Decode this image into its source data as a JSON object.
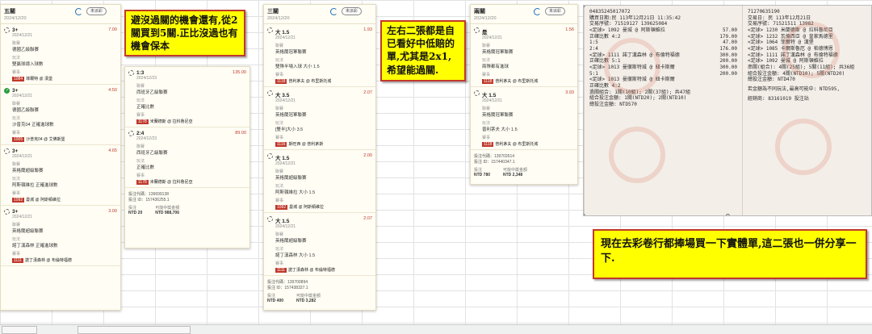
{
  "panels": {
    "p1": {
      "title": "五關",
      "date": "2024/12/20",
      "button": "未派彩",
      "bets": [
        {
          "sel": "3+",
          "date": "2024/12/21",
          "odds": "7.00",
          "state": "pending",
          "l1": "聯賽",
          "v1": "德國乙級聯賽",
          "l2": "玩法",
          "v2": "雙贏球總入球數",
          "l3": "賽事",
          "code": "1084",
          "match": "菲爾特 @ 漢堡"
        },
        {
          "sel": "3+",
          "date": "2024/12/21",
          "odds": "4.50",
          "state": "win",
          "l1": "聯賽",
          "v1": "德國乙級聯賽",
          "l2": "玩法",
          "v2": "沙普克04 正確進球數",
          "l3": "賽事",
          "code": "1005",
          "match": "沙普克04 @ 艾佛斯堡"
        },
        {
          "sel": "3+",
          "date": "2024/12/21",
          "odds": "4.65",
          "state": "pending",
          "l1": "聯賽",
          "v1": "英格蘭超級聯賽",
          "l2": "玩法",
          "v2": "阿斯頓維拉 正確進球數",
          "l3": "賽事",
          "code": "1092",
          "match": "曼城 @ 阿斯頓維拉"
        },
        {
          "sel": "3+",
          "date": "2024/12/21",
          "odds": "3.00",
          "state": "pending",
          "l1": "聯賽",
          "v1": "英格蘭超級聯賽",
          "l2": "玩法",
          "v2": "諾丁漢森林 正確進球數",
          "l3": "賽事",
          "code": "1111",
          "match": "諾丁漢森林 @ 布倫特福德"
        }
      ]
    },
    "p2": {
      "bets": [
        {
          "sel": "1:3",
          "date": "2024/12/23",
          "odds": "135.00",
          "l1": "聯賽",
          "v1": "西班牙乙級聯賽",
          "l2": "玩法",
          "v2": "正確比數",
          "l3": "賽事",
          "code": "1178",
          "match": "米蘭德斯 @ 拉科魯尼亞"
        },
        {
          "sel": "2:4",
          "date": "2024/12/23",
          "odds": "89.00",
          "l1": "聯賽",
          "v1": "西班牙乙級聯賽",
          "l2": "玩法",
          "v2": "正確比數",
          "l3": "賽事",
          "code": "1178",
          "match": "米蘭德斯 @ 拉科魯尼亞"
        }
      ],
      "foot_code": "投注代碼：139699138",
      "foot_id": "投注 ID：157436255.1",
      "stake_k": "投注",
      "stake_v": "NTD 20",
      "pay_k": "可能中獎金額",
      "pay_v": "NTD 988,706"
    },
    "p3": {
      "title": "三關",
      "date": "2024/12/20",
      "button": "未派彩",
      "bets": [
        {
          "sel": "大 1.5",
          "date": "2024/12/21",
          "odds": "1.93",
          "l1": "聯賽",
          "v1": "英格蘭冠軍聯賽",
          "l2": "玩法",
          "v2": "雙隊半場入球 大小 1.5",
          "l3": "賽事",
          "code": "1118",
          "match": "普利茅夫 @ 布里斯托城"
        },
        {
          "sel": "大 3.5",
          "date": "2024/12/21",
          "odds": "2.07",
          "l1": "聯賽",
          "v1": "英格蘭冠軍聯賽",
          "l2": "玩法",
          "v2": "[雙半]大小 3.5",
          "l3": "賽事",
          "code": "1116",
          "match": "斯旺西 @ 普利茅斯"
        },
        {
          "sel": "大 1.5",
          "date": "2024/12/21",
          "odds": "2.00",
          "l1": "聯賽",
          "v1": "英格蘭超級聯賽",
          "l2": "玩法",
          "v2": "阿斯頓維拉 大小 1.5",
          "l3": "賽事",
          "code": "1092",
          "match": "曼城 @ 阿斯頓維拉"
        },
        {
          "sel": "大 1.5",
          "date": "2024/12/21",
          "odds": "2.07",
          "l1": "聯賽",
          "v1": "英格蘭超級聯賽",
          "l2": "玩法",
          "v2": "諾丁漢森林 大小 1.5",
          "l3": "賽事",
          "code": "1111",
          "match": "諾丁漢森林 @ 布倫特福德"
        }
      ],
      "foot_code": "投注代碼：139700894",
      "foot_id": "投注 ID：157438327.1",
      "stake_k": "投注",
      "stake_v": "NTD 400",
      "pay_k": "可能中獎金額",
      "pay_v": "NTD 3,282"
    },
    "p4": {
      "title": "兩關",
      "date": "2024/12/20",
      "button": "未派彩",
      "bets": [
        {
          "sel": "是",
          "date": "2024/12/21",
          "odds": "1.56",
          "l1": "聯賽",
          "v1": "英格蘭冠軍聯賽",
          "l2": "玩法",
          "v2": "兩隊都有進球",
          "l3": "賽事",
          "code": "1118",
          "match": "普利茅夫 @ 布里斯托城"
        },
        {
          "sel": "大 1.5",
          "date": "2024/12/21",
          "odds": "3.93",
          "l1": "聯賽",
          "v1": "英格蘭冠軍聯賽",
          "l2": "玩法",
          "v2": "普利茅夫 大小 1.5",
          "l3": "賽事",
          "code": "1118",
          "match": "普利茅夫 @ 布里斯托城"
        }
      ],
      "foot_code": "投注代碼：139702614",
      "foot_id": "投注 ID：157440347.1",
      "stake_k": "投注",
      "stake_v": "NTD 780",
      "pay_k": "可能中獎金額",
      "pay_v": "NTD 2,348"
    }
  },
  "notes": {
    "n1": "避沒過關的機會還有,從2關買到5關.正比沒過也有機會保本",
    "n2": "左右二張都是自已看好中低賠的單,尤其是2x1,希望能過關.",
    "n3": "現在去彩卷行都捧場買一下實體單,這二張也一併分享一下."
  },
  "tickets": {
    "left": {
      "lines": [
        "04835245017072",
        "購買日期:民 113年12月21日 11:35:42",
        "交易序號: 71519127 139625084",
        "<足球> 1092 曼城 @ 阿斯頓維拉",
        "正確比數 4:2",
        "1:5",
        "2:4",
        "<足球> 1111 諾丁漢森林 @ 布倫特福德",
        "正確比數 5:1",
        "<足球> 1013 曼徹斯特城 @ 紐卡斯爾",
        "5:1",
        "<足球> 1013 曼徹斯特城 @ 紐卡斯爾",
        "正確比數 4:2",
        "過關組合: 1關(10組); 2關(37組); 共47組",
        "組合投注金額: 1關(NTD20); 2關(NTD10)",
        "總投注金額: NTD570"
      ],
      "amounts": [
        "57.00",
        "179.00",
        "47.00",
        "176.00",
        "300.00",
        "200.00",
        "300.00",
        "200.00"
      ]
    },
    "right": {
      "lines": [
        "71270635190",
        "交易日: 民 113年12月21日",
        "交易序號: 71521511 13982",
        "<足球> 1230 米蘭德斯 @ 拉科魯尼亞",
        "<足球> 1232 瓦倫西亞 @ 皇家馬德里",
        "<足球> 1064 菲爾特 @ 漢堡",
        "<足球> 1085 卡爾斯魯厄 @ 帕德博恩",
        "<足球> 1111 諾丁漢森林 @ 布倫特福德",
        "<足球> 1092 曼城 @ 阿斯頓維拉",
        "串關(組合): 4關(25組); 5關(11組); 共36組",
        "組合投注金額: 4關(NTD10); 5關(NTD20)",
        "總投注金額: NTD470"
      ],
      "footer": "若金額為不同玩法,最高可能中: NTD595,",
      "footer2": "經銷商: 83161019 投注站"
    }
  }
}
